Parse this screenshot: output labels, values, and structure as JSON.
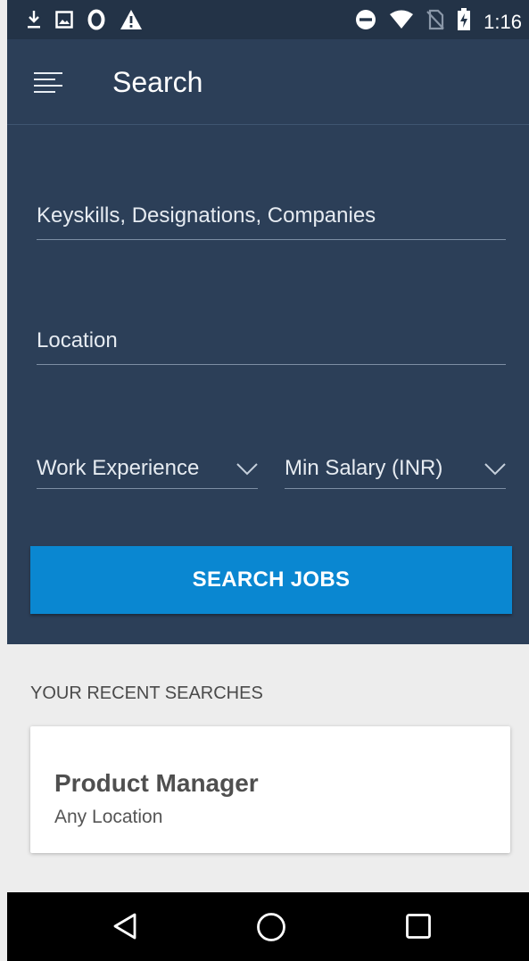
{
  "status_bar": {
    "time": "1:16",
    "left_icons": [
      "download-icon",
      "image-icon",
      "opera-icon",
      "warning-icon"
    ],
    "right_icons": [
      "do-not-disturb-icon",
      "wifi-icon",
      "no-sim-icon",
      "battery-charging-icon"
    ]
  },
  "app_bar": {
    "title": "Search",
    "menu_icon": "hamburger-menu-icon"
  },
  "search_form": {
    "keyskills_placeholder": "Keyskills, Designations, Companies",
    "location_placeholder": "Location",
    "work_experience_label": "Work Experience",
    "min_salary_label": "Min Salary (INR)",
    "search_button_label": "SEARCH JOBS"
  },
  "recent_searches": {
    "heading": "YOUR RECENT SEARCHES",
    "items": [
      {
        "title": "Product Manager",
        "location": "Any Location"
      }
    ]
  },
  "nav_bar": {
    "icons": [
      "back-icon",
      "home-icon",
      "recents-icon"
    ]
  },
  "colors": {
    "header_bg": "#2c3f58",
    "status_bg": "#233347",
    "accent": "#0a87d1",
    "page_bg": "#ededed"
  }
}
